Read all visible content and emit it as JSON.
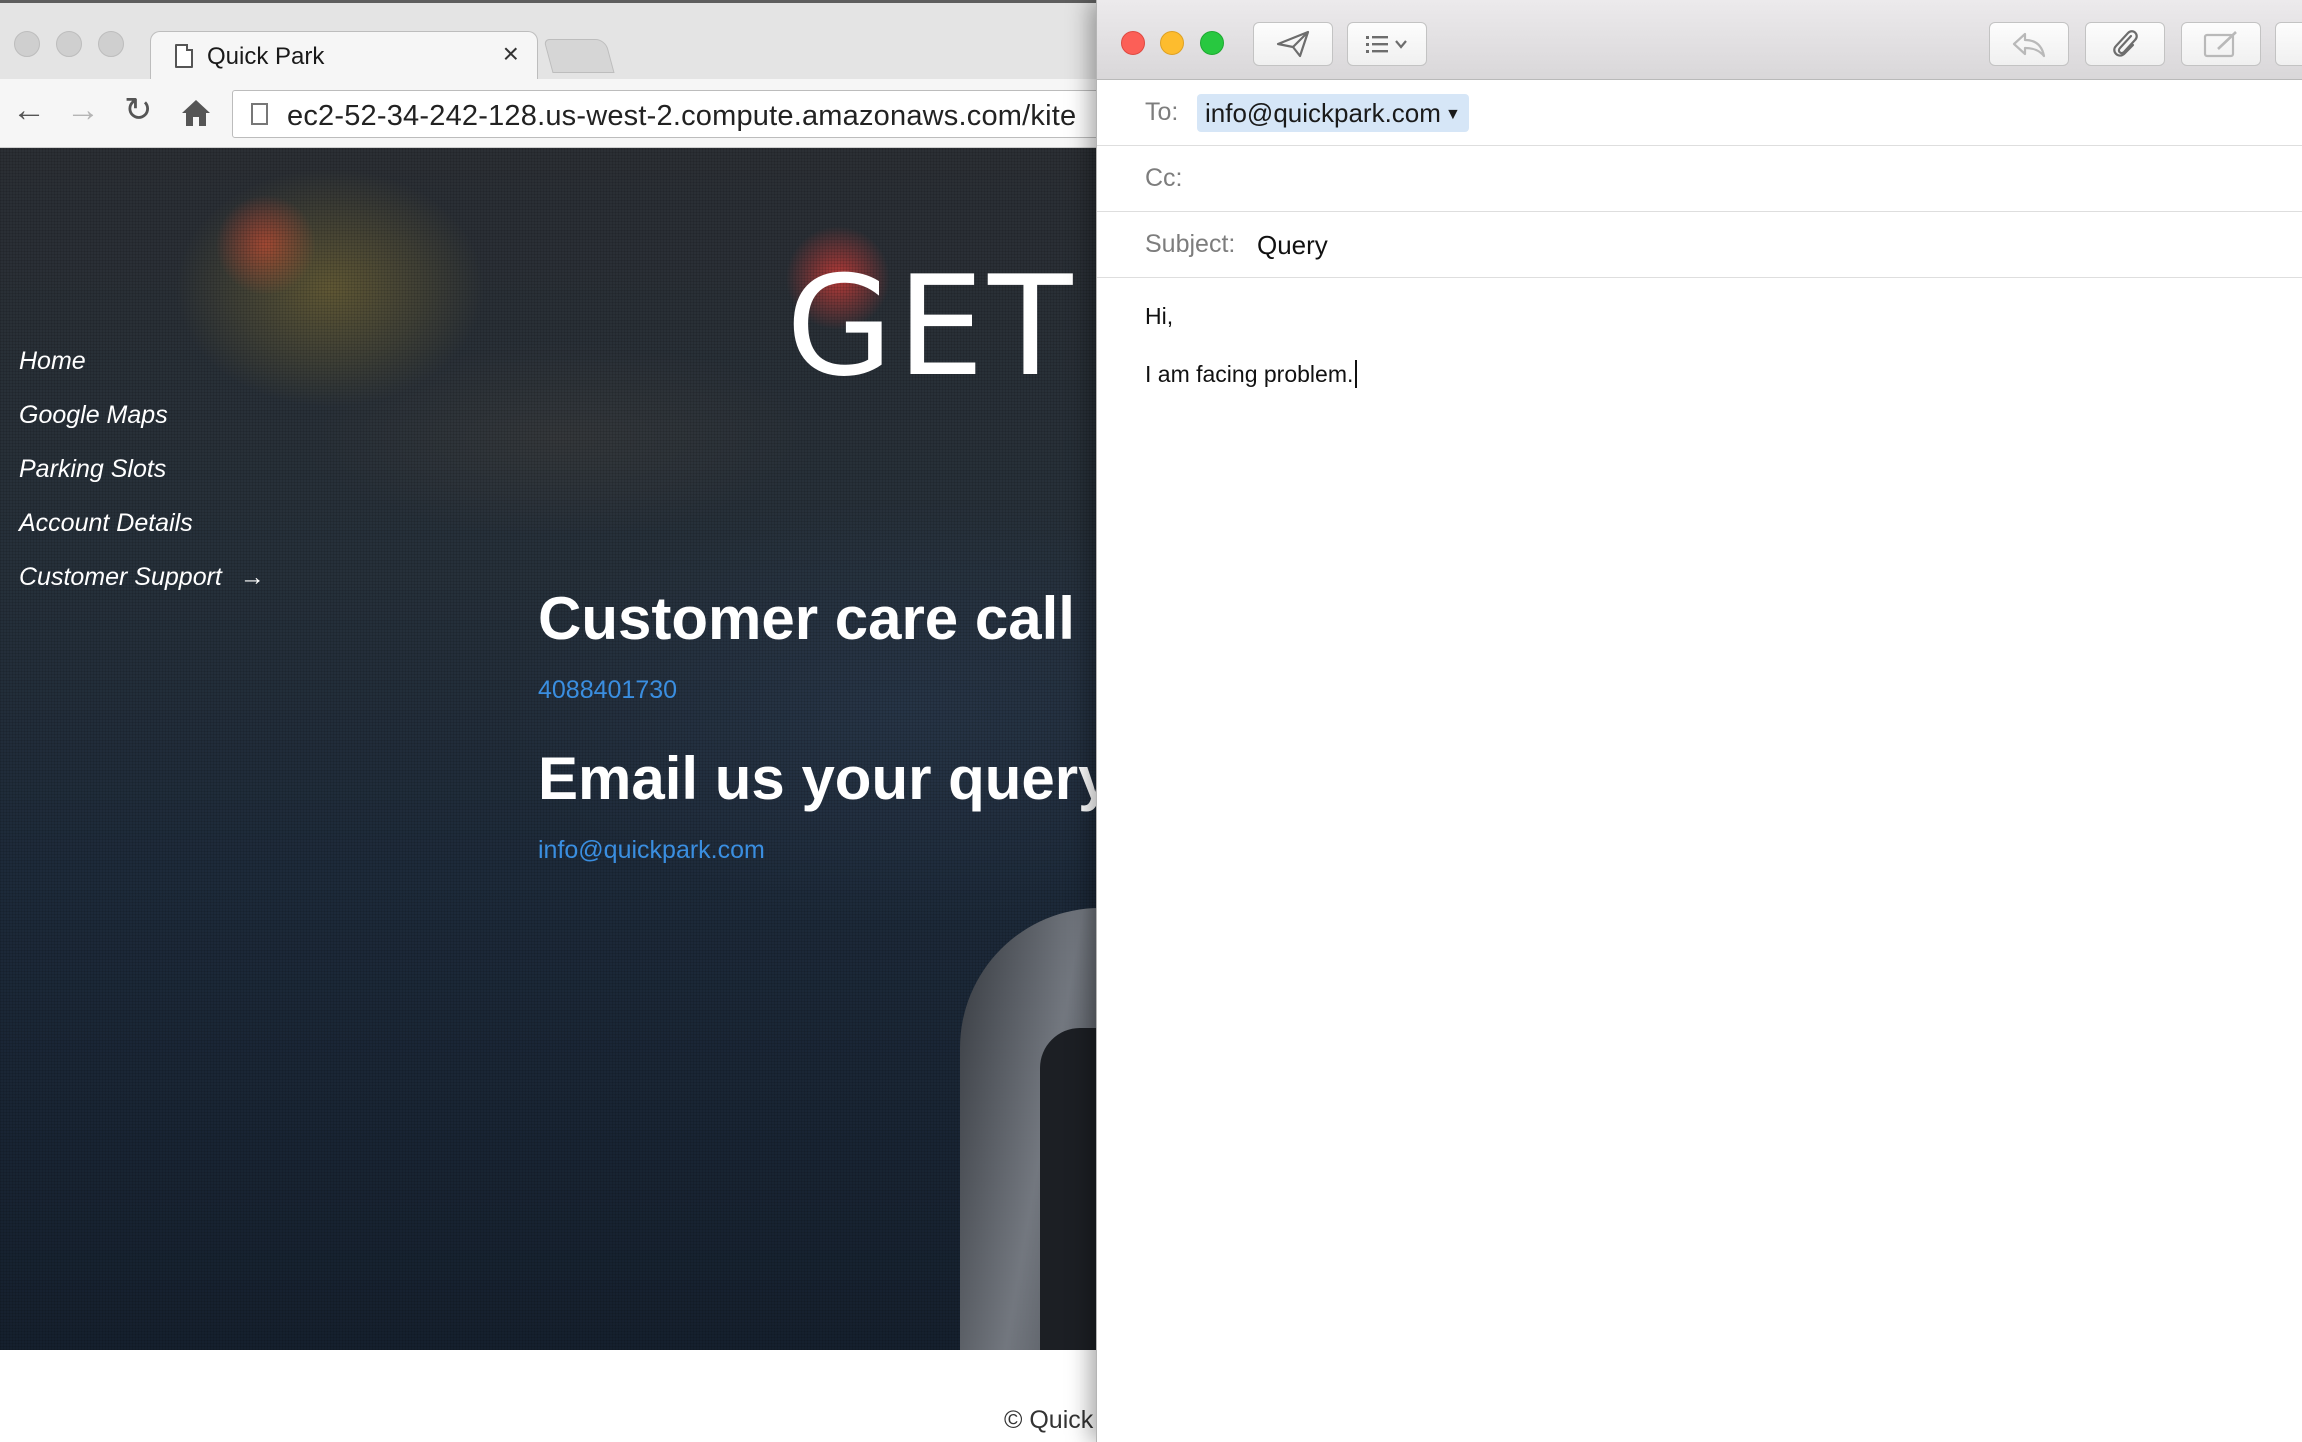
{
  "browser": {
    "tab": {
      "title": "Quick Park",
      "close_glyph": "×"
    },
    "url": "ec2-52-34-242-128.us-west-2.compute.amazonaws.com/kite",
    "icons": [
      "back-icon",
      "forward-icon",
      "reload-icon",
      "home-icon",
      "page-icon"
    ]
  },
  "site": {
    "nav": [
      {
        "label": "Home"
      },
      {
        "label": "Google Maps"
      },
      {
        "label": "Parking Slots"
      },
      {
        "label": "Account Details"
      },
      {
        "label": "Customer Support",
        "arrow": "→"
      }
    ],
    "hero_text": "GET",
    "customer_care_heading": "Customer care call",
    "phone": "4088401730",
    "email_heading": "Email us your query",
    "email": "info@quickpark.com",
    "footer_text": "© Quick",
    "colors": {
      "link": "#3a8ee0",
      "heading": "#ffffff"
    }
  },
  "mail": {
    "toolbar_icons": [
      "send-icon",
      "format-list-icon",
      "reply-icon",
      "attachment-icon",
      "markup-icon"
    ],
    "to_label": "To:",
    "to_value": "info@quickpark.com",
    "cc_label": "Cc:",
    "subject_label": "Subject:",
    "subject_value": "Query",
    "body_lines": [
      "Hi,",
      "I am facing problem."
    ],
    "colors": {
      "close": "#fc5f57",
      "minimize": "#fdbc2e",
      "maximize": "#28c840",
      "token_bg": "#d6e6f7"
    }
  }
}
